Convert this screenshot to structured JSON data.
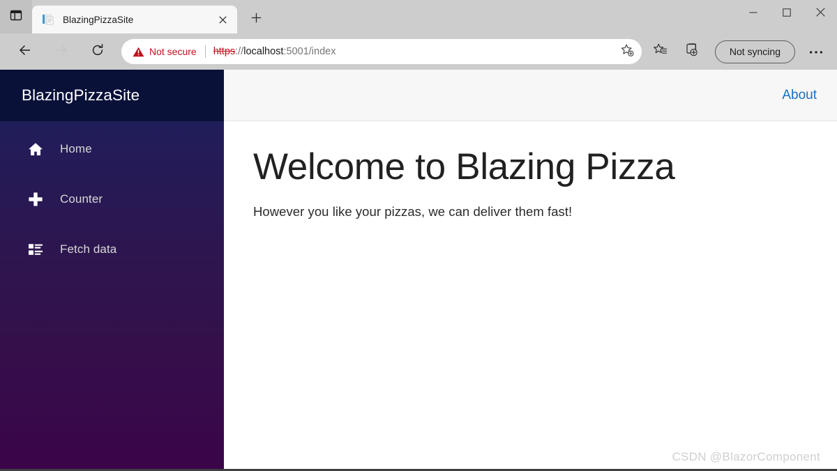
{
  "browser": {
    "tab_actions_icon": "tab-actions-icon",
    "tab": {
      "favicon": "page-favicon",
      "title": "BlazingPizzaSite",
      "close_icon": "close-icon"
    },
    "new_tab_icon": "plus-icon",
    "window_controls": {
      "minimize_icon": "minimize-icon",
      "maximize_icon": "maximize-icon",
      "close_icon": "close-icon"
    },
    "toolbar": {
      "back_icon": "back-arrow-icon",
      "forward_icon": "forward-arrow-icon",
      "reload_icon": "reload-icon",
      "security_warning_icon": "warning-triangle-icon",
      "security_label": "Not secure",
      "url_scheme": "https",
      "url_separator": "://",
      "url_host": "localhost",
      "url_rest": ":5001/index",
      "url_full": "https://localhost:5001/index",
      "favorite_icon": "star-add-icon",
      "favorites_icon": "favorites-icon",
      "collections_icon": "collections-icon",
      "sync_label": "Not syncing",
      "more_icon": "ellipsis-icon"
    },
    "colors": {
      "chrome_bg": "#cdcdcd",
      "tab_bg": "#f7f7f7",
      "warning_red": "#c50f1f"
    }
  },
  "app": {
    "brand": "BlazingPizzaSite",
    "sidebar": {
      "items": [
        {
          "label": "Home",
          "icon": "home-icon"
        },
        {
          "label": "Counter",
          "icon": "plus-icon"
        },
        {
          "label": "Fetch data",
          "icon": "list-alt-icon"
        }
      ],
      "gradient_start": "#1a2260",
      "gradient_end": "#3b0449",
      "header_bg": "#0a1139"
    },
    "top_row": {
      "about_label": "About",
      "link_color": "#1b6ec2"
    },
    "main": {
      "title": "Welcome to Blazing Pizza",
      "subtitle": "However you like your pizzas, we can deliver them fast!"
    },
    "watermark": "CSDN @BlazorComponent"
  }
}
